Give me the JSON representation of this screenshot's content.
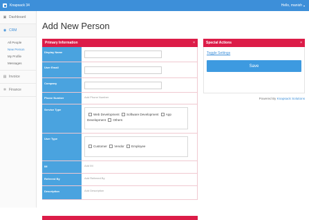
{
  "topbar": {
    "app_name": "Knapsack 34",
    "user_label": "Hello, manish",
    "caret": "▾"
  },
  "sidebar": {
    "dashboard": "Dashboard",
    "crm": "CRM",
    "crm_items": [
      "All People",
      "New Person",
      "My Profile",
      "Messages"
    ],
    "invoice": "Invoice",
    "finance": "Finance"
  },
  "page": {
    "title": "Add New Person"
  },
  "primary": {
    "header": "Primary Information",
    "close": "×",
    "display_name_label": "Display Name",
    "user_email_label": "User Email",
    "company_label": "Company",
    "phone_label": "Phone Number",
    "phone_placeholder": "Add Phone Number",
    "service_type_label": "Service Type",
    "service_types": [
      "Web Development",
      "Software Development",
      "App Development",
      "Others"
    ],
    "user_type_label": "User Type",
    "user_types": [
      "Customer",
      "Vendor",
      "Employee"
    ],
    "im_label": "IM",
    "im_placeholder": "Add IM",
    "referred_by_label": "Referred By",
    "referred_by_placeholder": "Add Referred By",
    "description_label": "Description",
    "description_placeholder": "Add Description"
  },
  "special": {
    "header": "Special Actions",
    "close": "×",
    "toggle_settings": "Toggle Settings",
    "save": "Save"
  },
  "footer": {
    "powered_by": "Powered By",
    "company": "Knapsack Solutions"
  },
  "colors": {
    "topbar": "#3d8fd9",
    "panel_header": "#dc1c48",
    "label_bg": "#4aa3df",
    "save": "#3d9ae0"
  }
}
